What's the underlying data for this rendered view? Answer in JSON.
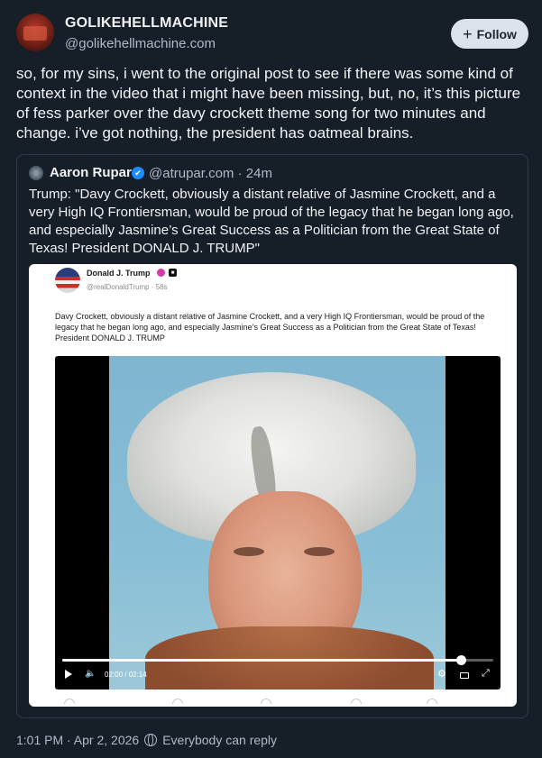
{
  "author": {
    "display_name": "GOLIKEHELLMACHINE",
    "handle": "@golikehellmachine.com"
  },
  "follow_button": {
    "plus": "+",
    "label": "Follow"
  },
  "post_text": "so, for my sins, i went to the original post to see if there was some kind of context in the video that i might have been missing, but, no, it’s this picture of fess parker over the davy crockett theme song for two minutes and change. i’ve got nothing, the president has oatmeal brains.",
  "quote": {
    "display_name": "Aaron Rupar",
    "verified_mark": "✔",
    "handle_time": "@atrupar.com · 24m",
    "text": "Trump: \"Davy Crockett, obviously a distant relative of Jasmine Crockett, and a very High IQ Frontiersman, would be proud of the legacy that he began long ago, and especially Jasmine’s Great Success as a Politician from the Great State of Texas! President DONALD J. TRUMP\""
  },
  "embed": {
    "display_name": "Donald J. Trump",
    "handle_time": "@realDonaldTrump · 58s",
    "text": "Davy Crockett, obviously a distant relative of Jasmine Crockett, and a very High IQ Frontiersman, would be proud of the legacy that he began long ago, and especially Jasmine’s Great Success as a Politician from the Great State of Texas! President DONALD J. TRUMP",
    "video": {
      "time": "02:00 / 02:14",
      "progress_fraction": 0.925
    }
  },
  "footer": {
    "timestamp": "1:01 PM · Apr 2, 2026",
    "reply_setting": "Everybody can reply"
  }
}
